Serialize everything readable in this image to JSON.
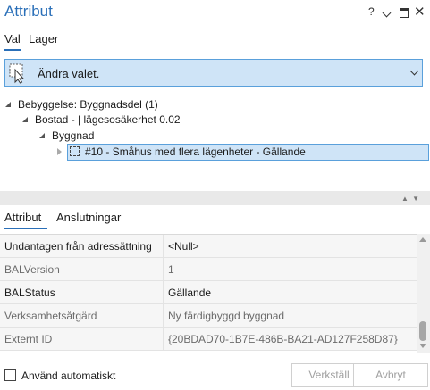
{
  "window": {
    "title": "Attribut",
    "help": "?",
    "close": "✕"
  },
  "tabs": {
    "val": "Val",
    "lager": "Lager"
  },
  "selection": {
    "text": "Ändra valet."
  },
  "tree": {
    "level1": "Bebyggelse: Byggnadsdel (1)",
    "level2": "Bostad -  | lägesosäkerhet 0.02",
    "level3": "Byggnad",
    "leaf": "#10 - Småhus med flera lägenheter - Gällande"
  },
  "lower_tabs": {
    "attribut": "Attribut",
    "anslutningar": "Anslutningar"
  },
  "attributes": [
    {
      "name": "Undantagen från adressättning",
      "value": "<Null>",
      "muted": false
    },
    {
      "name": "BALVersion",
      "value": "1",
      "muted": true
    },
    {
      "name": "BALStatus",
      "value": "Gällande",
      "muted": false
    },
    {
      "name": "Verksamhetsåtgärd",
      "value": "Ny färdigbyggd byggnad",
      "muted": true
    },
    {
      "name": "Externt ID",
      "value": "{20BDAD70-1B7E-486B-BA21-AD127F258D87}",
      "muted": true
    }
  ],
  "footer": {
    "auto_label": "Använd automatiskt",
    "apply_label": "Verkställ",
    "cancel_label": "Avbryt"
  },
  "colors": {
    "accent": "#2a6fb8",
    "selection": "#cfe4f7"
  }
}
